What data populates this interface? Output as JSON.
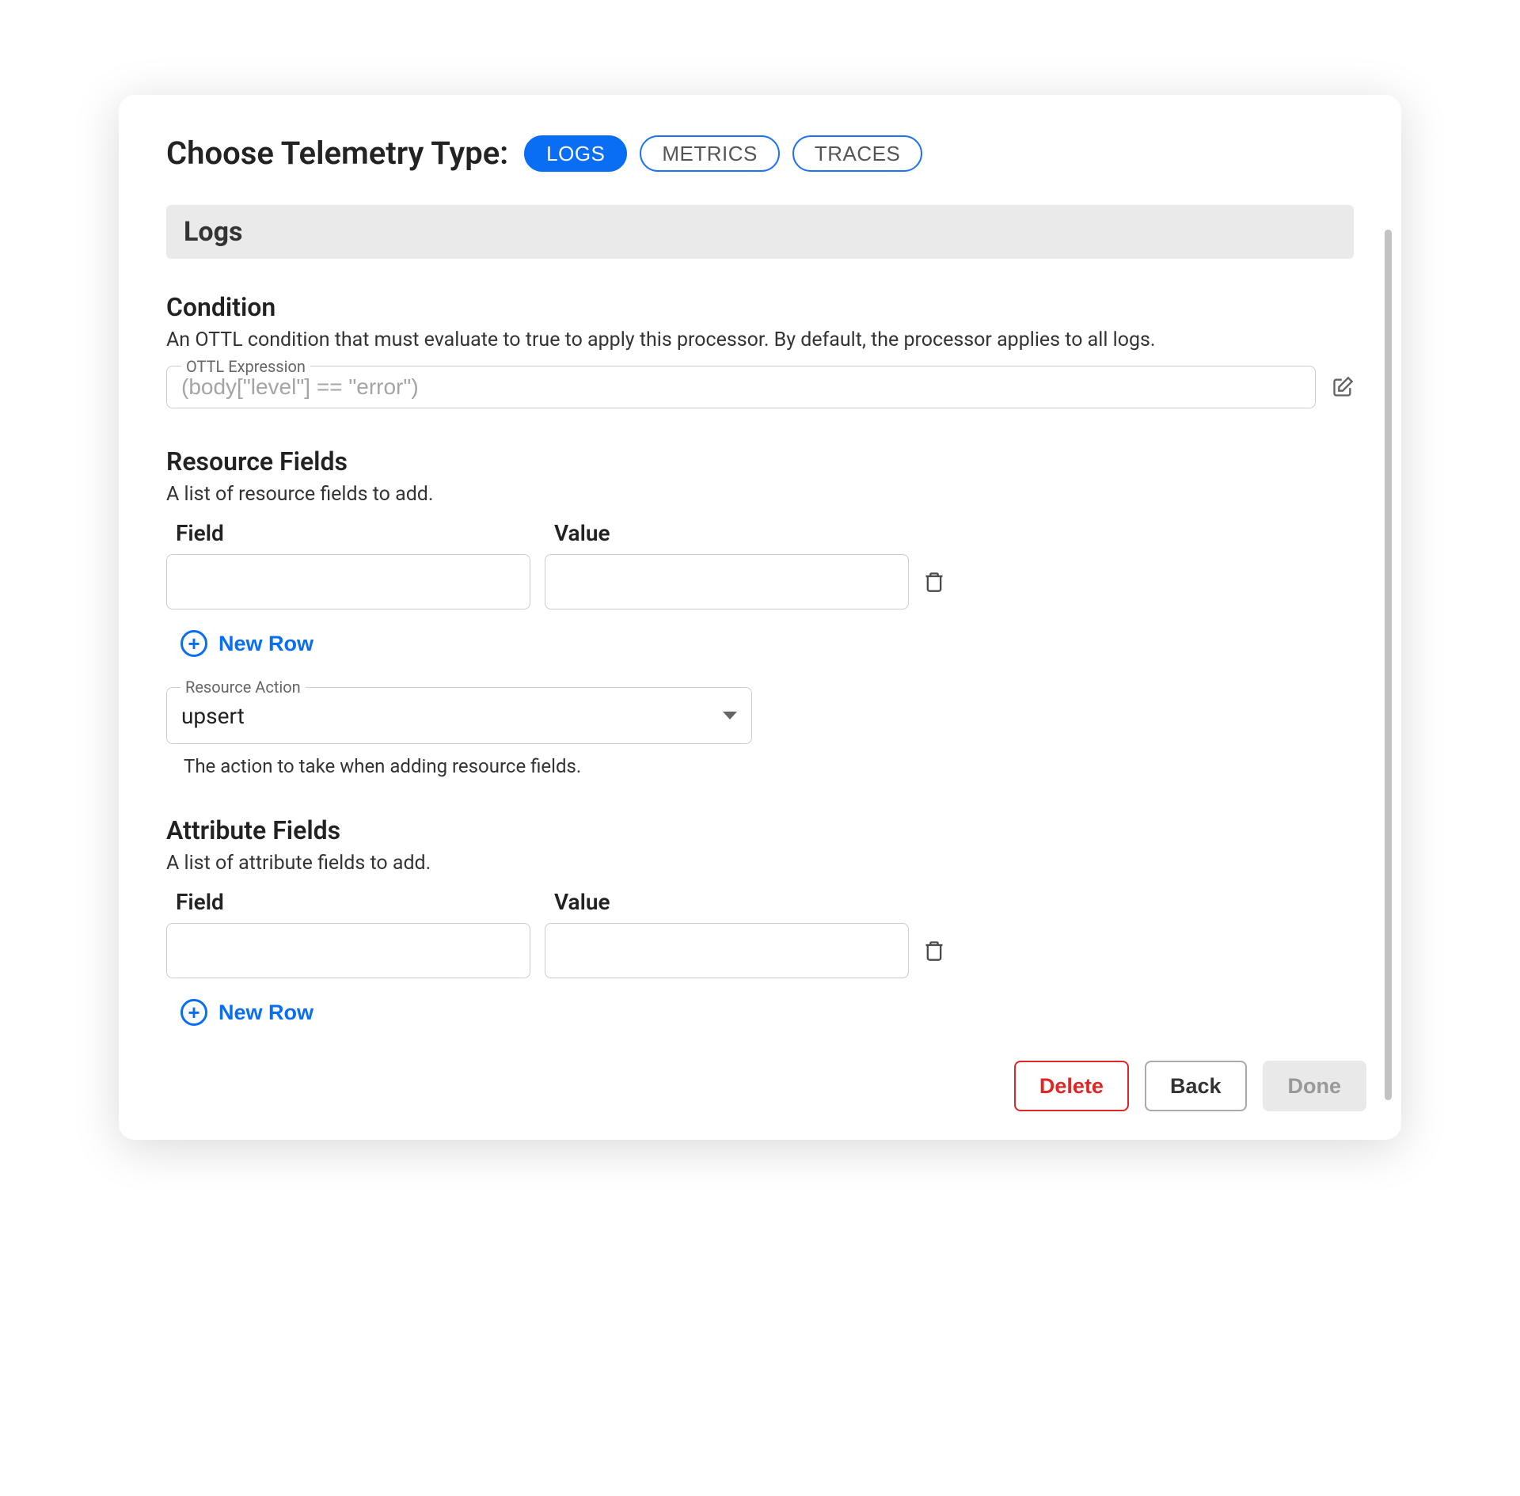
{
  "header": {
    "title": "Choose Telemetry Type:",
    "pills": [
      "LOGS",
      "METRICS",
      "TRACES"
    ],
    "selected": "LOGS"
  },
  "sectionBar": "Logs",
  "condition": {
    "title": "Condition",
    "desc": "An OTTL condition that must evaluate to true to apply this processor. By default, the processor applies to all logs.",
    "legend": "OTTL Expression",
    "placeholder": "(body[\"level\"] == \"error\")",
    "value": ""
  },
  "resource": {
    "title": "Resource Fields",
    "desc": "A list of resource fields to add.",
    "headers": {
      "field": "Field",
      "value": "Value"
    },
    "rows": [
      {
        "field": "",
        "value": ""
      }
    ],
    "newRow": "New Row",
    "action": {
      "legend": "Resource Action",
      "value": "upsert",
      "helper": "The action to take when adding resource fields."
    }
  },
  "attribute": {
    "title": "Attribute Fields",
    "desc": "A list of attribute fields to add.",
    "headers": {
      "field": "Field",
      "value": "Value"
    },
    "rows": [
      {
        "field": "",
        "value": ""
      }
    ],
    "newRow": "New Row"
  },
  "footer": {
    "delete": "Delete",
    "back": "Back",
    "done": "Done"
  }
}
